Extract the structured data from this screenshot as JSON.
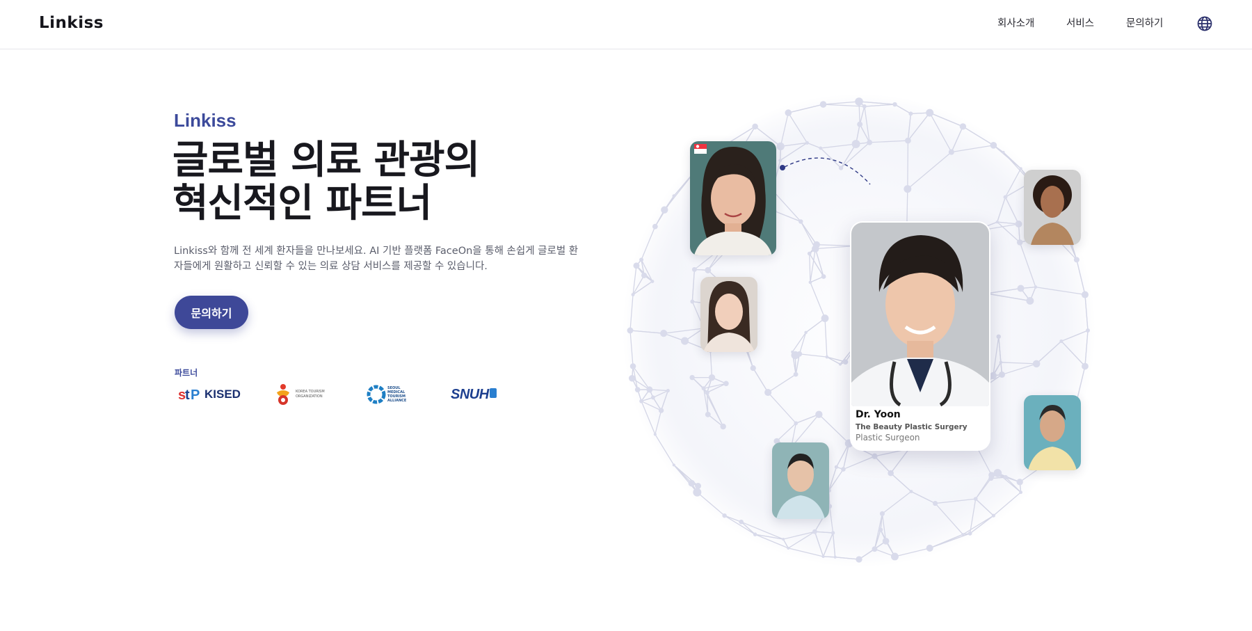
{
  "header": {
    "brand": "Linkiss",
    "nav": [
      "회사소개",
      "서비스",
      "문의하기"
    ],
    "globe_icon": "globe-icon"
  },
  "hero": {
    "eyebrow": "Linkiss",
    "title_line1": "글로벌 의료 관광의",
    "title_line2": "혁신적인 파트너",
    "description": "Linkiss와 함께 전 세계 환자들을 만나보세요. AI 기반 플랫폼 FaceOn을 통해 손쉽게 글로벌 환자들에게 원활하고 신뢰할 수 있는 의료 상담 서비스를 제공할 수 있습니다.",
    "cta_label": "문의하기",
    "partners_label": "파트너"
  },
  "partners": [
    {
      "name": "KISED",
      "text": "KISED"
    },
    {
      "name": "korea-tourism-organization",
      "text": "KOREA TOURISM ORGANIZATION"
    },
    {
      "name": "seoul-medical-tourism-alliance",
      "text": "SEOUL MEDICAL TOURISM ALLIANCE"
    },
    {
      "name": "snuh",
      "text": "SNUH"
    }
  ],
  "doctor_card": {
    "name": "Dr. Yoon",
    "clinic": "The Beauty Plastic Surgery",
    "role": "Plastic Surgeon"
  },
  "colors": {
    "accent": "#3e4898",
    "text": "#18181e",
    "muted": "#5a5d6b"
  }
}
